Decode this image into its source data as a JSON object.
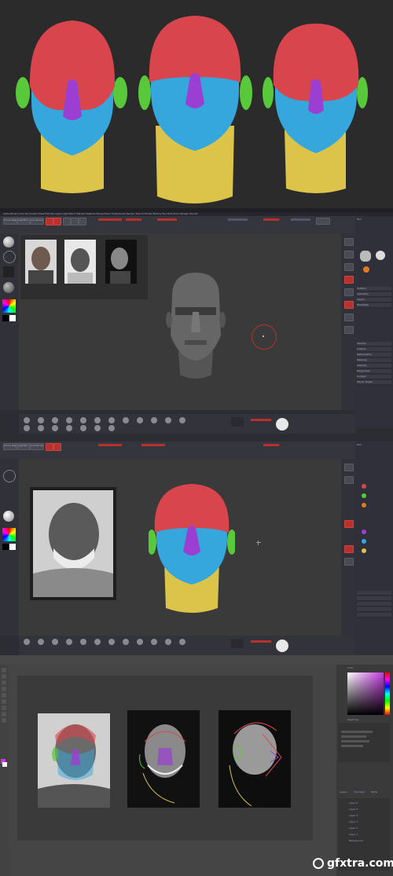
{
  "watermark": {
    "text": "gfxtra.com"
  },
  "colors": {
    "cranium": "#d9454d",
    "face": "#35a7dc",
    "nose": "#9b3fd3",
    "ears": "#59c93c",
    "neck": "#dcc44a",
    "background": "#2a2a2a",
    "zbrush_panel": "#30303a",
    "zbrush_accent": "#b8312c"
  },
  "zbrush1": {
    "menu": [
      "Alpha",
      "Brush",
      "Color",
      "Document",
      "Draw",
      "Edit",
      "File",
      "Layer",
      "Light",
      "Macro",
      "Marker",
      "Material",
      "Movie",
      "Picker",
      "Preferences",
      "Render",
      "Stencil",
      "Stroke",
      "Texture",
      "Tool",
      "Transform",
      "Zplugin",
      "Zscript"
    ],
    "top_buttons": [
      "Home Page",
      "LightBox",
      "Live Boolean"
    ],
    "tray_title": "Tool",
    "subtools": [
      "SubTool",
      "Geometry",
      "Layers",
      "FiberMesh",
      "Preview",
      "Surface",
      "Deformation",
      "Masking",
      "Visibility",
      "Polygroups",
      "Contact",
      "Morph Target"
    ]
  },
  "zbrush2": {
    "top_buttons": [
      "Home Page",
      "LightBox",
      "Live Boolean"
    ],
    "tray_title": "Tool"
  },
  "photoshop": {
    "panel_titles": [
      "Color",
      "Swatches",
      "Layers",
      "Channels",
      "Paths"
    ],
    "layers": [
      "Layer 6",
      "Layer 5",
      "Layer 4",
      "Layer 3",
      "Layer 2",
      "Layer 1",
      "Background"
    ]
  }
}
